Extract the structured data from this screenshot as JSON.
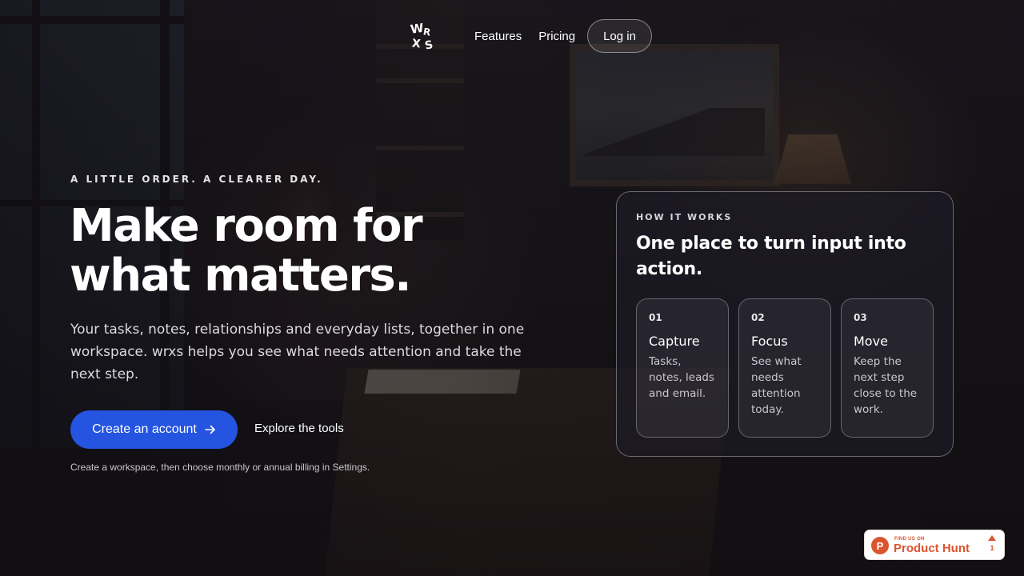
{
  "brand": {
    "logo_text": "WRXS"
  },
  "nav": {
    "links": [
      {
        "label": "Features"
      },
      {
        "label": "Pricing"
      }
    ],
    "login_label": "Log in"
  },
  "hero": {
    "eyebrow": "A LITTLE ORDER. A CLEARER DAY.",
    "headline": "Make room for what matters.",
    "subcopy": "Your tasks, notes, relationships and everyday lists, together in one workspace. wrxs helps you see what needs attention and take the next step.",
    "cta_primary": "Create an account",
    "cta_primary_icon": "arrow-right-icon",
    "cta_secondary": "Explore the tools",
    "footnote": "Create a workspace, then choose monthly or annual billing in Settings."
  },
  "how_it_works": {
    "eyebrow": "HOW IT WORKS",
    "title": "One place to turn input into action.",
    "steps": [
      {
        "num": "01",
        "title": "Capture",
        "desc": "Tasks, notes, leads and email."
      },
      {
        "num": "02",
        "title": "Focus",
        "desc": "See what needs attention today."
      },
      {
        "num": "03",
        "title": "Move",
        "desc": "Keep the next step close to the work."
      }
    ]
  },
  "product_hunt": {
    "small": "FIND US ON",
    "name": "Product Hunt",
    "logo_letter": "P",
    "votes": "1",
    "color": "#da552f"
  },
  "colors": {
    "accent": "#2454e0",
    "background": "#16131a"
  }
}
